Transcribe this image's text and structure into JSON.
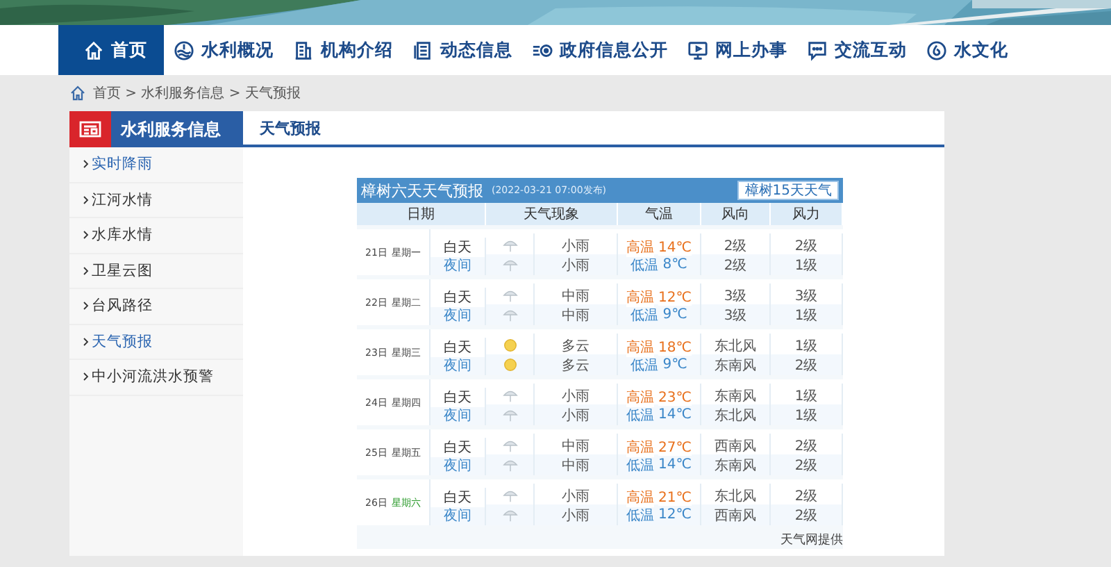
{
  "nav": [
    {
      "label": "首页",
      "kind": "home",
      "selected": true
    },
    {
      "label": "水利概况",
      "kind": "water",
      "selected": false
    },
    {
      "label": "机构介绍",
      "kind": "building",
      "selected": false
    },
    {
      "label": "动态信息",
      "kind": "document",
      "selected": false
    },
    {
      "label": "政府信息公开",
      "kind": "list",
      "selected": false
    },
    {
      "label": "网上办事",
      "kind": "monitor",
      "selected": false
    },
    {
      "label": "交流互动",
      "kind": "chat",
      "selected": false
    },
    {
      "label": "水文化",
      "kind": "drop",
      "selected": false
    }
  ],
  "breadcrumb": {
    "text": "首页 > 水利服务信息 > 天气预报"
  },
  "sidebar": {
    "title": "水利服务信息",
    "items": [
      {
        "label": "实时降雨",
        "highlighted": true
      },
      {
        "label": "江河水情",
        "highlighted": false
      },
      {
        "label": "水库水情",
        "highlighted": false
      },
      {
        "label": "卫星云图",
        "highlighted": false
      },
      {
        "label": "台风路径",
        "highlighted": false
      },
      {
        "label": "天气预报",
        "highlighted": true
      },
      {
        "label": "中小河流洪水预警",
        "highlighted": false
      }
    ]
  },
  "content": {
    "title": "天气预报"
  },
  "forecast": {
    "title": "樟树六天天气预报",
    "published": "(2022-03-21 07:00发布)",
    "button": "樟树15天天气",
    "columns": [
      "日期",
      "天气现象",
      "气温",
      "风向",
      "风力"
    ],
    "days": [
      {
        "date": "21日",
        "weekday": "星期一",
        "weekend": false,
        "rows": [
          {
            "period": "白天",
            "kind": "rain",
            "desc": "小雨",
            "temp_label": "高温",
            "temp": "14℃",
            "wind_dir": "2级",
            "wind": "2级"
          },
          {
            "period": "夜间",
            "kind": "rain",
            "desc": "小雨",
            "temp_label": "低温",
            "temp": "8℃",
            "wind_dir": "2级",
            "wind": "1级"
          }
        ]
      },
      {
        "date": "22日",
        "weekday": "星期二",
        "weekend": false,
        "rows": [
          {
            "period": "白天",
            "kind": "rain",
            "desc": "中雨",
            "temp_label": "高温",
            "temp": "12℃",
            "wind_dir": "3级",
            "wind": "3级"
          },
          {
            "period": "夜间",
            "kind": "rain",
            "desc": "中雨",
            "temp_label": "低温",
            "temp": "9℃",
            "wind_dir": "3级",
            "wind": "1级"
          }
        ]
      },
      {
        "date": "23日",
        "weekday": "星期三",
        "weekend": false,
        "rows": [
          {
            "period": "白天",
            "kind": "cloudy",
            "desc": "多云",
            "temp_label": "高温",
            "temp": "18℃",
            "wind_dir": "东北风",
            "wind": "1级"
          },
          {
            "period": "夜间",
            "kind": "cloudy",
            "desc": "多云",
            "temp_label": "低温",
            "temp": "9℃",
            "wind_dir": "东南风",
            "wind": "2级"
          }
        ]
      },
      {
        "date": "24日",
        "weekday": "星期四",
        "weekend": false,
        "rows": [
          {
            "period": "白天",
            "kind": "rain",
            "desc": "小雨",
            "temp_label": "高温",
            "temp": "23℃",
            "wind_dir": "东南风",
            "wind": "1级"
          },
          {
            "period": "夜间",
            "kind": "rain",
            "desc": "小雨",
            "temp_label": "低温",
            "temp": "14℃",
            "wind_dir": "东北风",
            "wind": "1级"
          }
        ]
      },
      {
        "date": "25日",
        "weekday": "星期五",
        "weekend": false,
        "rows": [
          {
            "period": "白天",
            "kind": "rain",
            "desc": "中雨",
            "temp_label": "高温",
            "temp": "27℃",
            "wind_dir": "西南风",
            "wind": "2级"
          },
          {
            "period": "夜间",
            "kind": "rain",
            "desc": "中雨",
            "temp_label": "低温",
            "temp": "14℃",
            "wind_dir": "东南风",
            "wind": "2级"
          }
        ]
      },
      {
        "date": "26日",
        "weekday": "星期六",
        "weekend": true,
        "rows": [
          {
            "period": "白天",
            "kind": "rain",
            "desc": "小雨",
            "temp_label": "高温",
            "temp": "21℃",
            "wind_dir": "东北风",
            "wind": "2级"
          },
          {
            "period": "夜间",
            "kind": "rain",
            "desc": "小雨",
            "temp_label": "低温",
            "temp": "12℃",
            "wind_dir": "西南风",
            "wind": "2级"
          }
        ]
      }
    ],
    "footer": "天气网提供"
  }
}
